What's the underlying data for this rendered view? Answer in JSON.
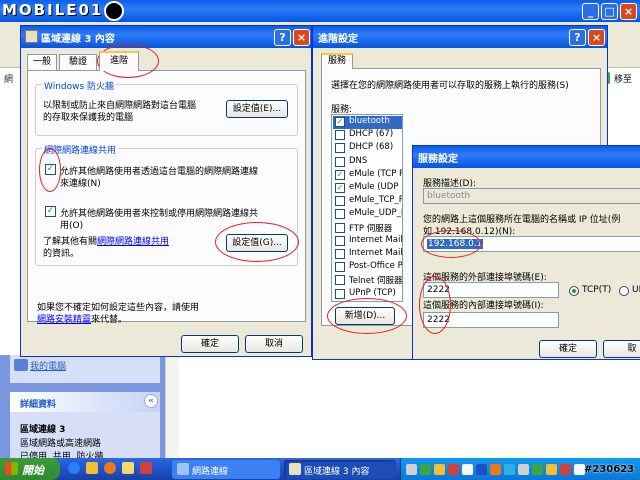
{
  "colors": {
    "accent": "#0a5fe8",
    "annotation": "#e0201c",
    "checkmark": "#21a121",
    "link": "#0000ff"
  },
  "watermark": "MOBILE01",
  "bg_window": {
    "btn_min": "_",
    "btn_max": "□",
    "btn_close": "×",
    "nav_label": "網",
    "goto_label": "移至"
  },
  "props_dialog": {
    "title": "區域連線 3 內容",
    "help": "?",
    "close": "×",
    "tabs": [
      "一般",
      "驗證",
      "進階"
    ],
    "firewall": {
      "legend": "Windows 防火牆",
      "line1": "以限制或防止來自網際網路對這台電腦",
      "line2": "的存取來保護我的電腦",
      "settings": "設定值(E)..."
    },
    "ics": {
      "legend": "網際網路連線共用",
      "check1_line1": "允許其他網路使用者透過這台電腦的網際網路連線",
      "check1_line2": "來連線(N)",
      "check2_line1": "允許其他網路使用者來控制或停用網際網路連線共",
      "check2_line2": "用(O)",
      "learn_prefix": "了解其他有關",
      "learn_link": "網際網路連線共用",
      "learn_suffix": "的資訊。",
      "settings": "設定值(G)..."
    },
    "bottom_line1": "如果您不確定如何設定這些內容，請使用",
    "bottom_link": "網路安裝精靈",
    "bottom_suffix": "來代替。",
    "ok": "確定",
    "cancel": "取消"
  },
  "advanced": {
    "title": "進階設定",
    "help": "?",
    "close": "×",
    "tab": "服務",
    "desc": "選擇在您的網際網路上執行的服務 ( S )",
    "desc_text": "選擇在您的網際網路使用者可以存取的服務上執行的服務(S)",
    "services_label": "服務:",
    "services": [
      {
        "name": "bluetooth",
        "checked": true,
        "selected": true
      },
      {
        "name": "DHCP (67)",
        "checked": false
      },
      {
        "name": "DHCP (68)",
        "checked": false
      },
      {
        "name": "DNS",
        "checked": false
      },
      {
        "name": "eMule (TCP Port)",
        "checked": true
      },
      {
        "name": "eMule (UDP Port)",
        "checked": true
      },
      {
        "name": "eMule_TCP_Port",
        "checked": false
      },
      {
        "name": "eMule_UDP_Port",
        "checked": false
      },
      {
        "name": "FTP 伺服器",
        "checked": false
      },
      {
        "name": "Internet Mail Access",
        "checked": false
      },
      {
        "name": "Internet Mail Access",
        "checked": false
      },
      {
        "name": "Post-Office Protocol",
        "checked": false
      },
      {
        "name": "Telnet 伺服器",
        "checked": false
      },
      {
        "name": "UPnP (TCP)",
        "checked": false
      }
    ],
    "add": "新增(D)..."
  },
  "service_settings": {
    "title": "服務設定",
    "desc_label": "服務描述(D):",
    "desc_value": "bluetooth",
    "host_line1": "您的網路上這個服務所在電腦的名稱或 IP 位址(例",
    "host_line2": "如 192.168.0.12)(N):",
    "host_value": "192.168.0.1",
    "ext_label": "這個服務的外部連接埠號碼(E):",
    "ext_value": "2222",
    "int_label": "這個服務的內部連接埠號碼(I):",
    "int_value": "2222",
    "tcp": "TCP(T)",
    "udp": "UD",
    "ok": "確定",
    "cancel": "取"
  },
  "sidebar": {
    "my_computer": "我的電腦",
    "details_title": "詳細資料",
    "conn_name": "區域連線 3",
    "conn_desc": "區域網路或高速網路",
    "conn_more": "已停用, 共用, 防火牆",
    "collapse": "«"
  },
  "taskbar": {
    "start": "開始",
    "task1": "網路連線",
    "task2": "區域連線 3 內容",
    "clock": "#230623"
  }
}
